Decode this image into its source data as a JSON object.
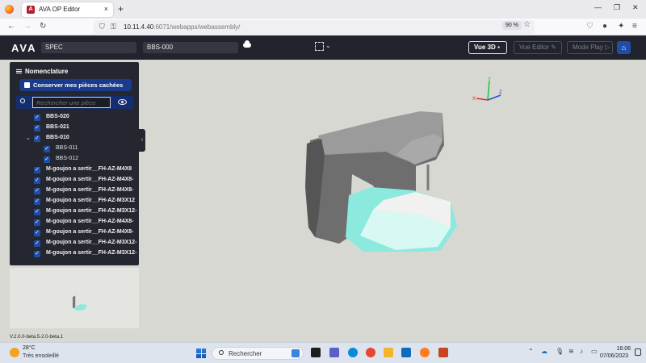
{
  "browser": {
    "tab_title": "AVA OP Editor",
    "tab_close": "×",
    "new_tab": "+",
    "url_host": "10.11.4.40",
    "url_rest": ":6071/webapps/webassembly/",
    "zoom": "90 %"
  },
  "app": {
    "logo": "AVA",
    "field_spec": "SPEC",
    "field_ref": "BBS-000",
    "btn_vue3d": "Vue 3D",
    "btn_vue_editor": "Vue Editor",
    "btn_mode_play": "Mode Play"
  },
  "panel": {
    "title": "Nomenclature",
    "keep_hidden_label": "Conserver mes pièces cachées",
    "search_placeholder": "Rechercher une pièce",
    "items": [
      {
        "label": "BBS-020",
        "level": 0
      },
      {
        "label": "BBS-021",
        "level": 0
      },
      {
        "label": "BBS-010",
        "level": 0,
        "expanded": true
      },
      {
        "label": "BBS-011",
        "level": 1
      },
      {
        "label": "BBS-012",
        "level": 1
      },
      {
        "label": "M-goujon a sertir__FH-AZ-M4X8",
        "level": 0
      },
      {
        "label": "M-goujon a sertir__FH-AZ-M4X8-",
        "level": 0
      },
      {
        "label": "M-goujon a sertir__FH-AZ-M4X8-",
        "level": 0
      },
      {
        "label": "M-goujon a sertir__FH-AZ-M3X12",
        "level": 0
      },
      {
        "label": "M-goujon a sertir__FH-AZ-M3X12-",
        "level": 0
      },
      {
        "label": "M-goujon a sertir__FH-AZ-M4X8-",
        "level": 0
      },
      {
        "label": "M-goujon a sertir__FH-AZ-M4X8-",
        "level": 0
      },
      {
        "label": "M-goujon a sertir__FH-AZ-M3X12-",
        "level": 0
      },
      {
        "label": "M-goujon a sertir__FH-AZ-M3X12-",
        "level": 0
      }
    ]
  },
  "axes": {
    "y": "Y",
    "x": "X",
    "z": "Z"
  },
  "version": "V.2.0.0-beta.5-2.0-beta.1",
  "taskbar": {
    "temp": "28°C",
    "weather": "Très ensoleillé",
    "search": "Rechercher",
    "time": "16:06",
    "date": "07/06/2023"
  },
  "colors": {
    "header_bg": "#21242d",
    "accent": "#1f4da8",
    "highlight_part": "#7ff2e6"
  }
}
